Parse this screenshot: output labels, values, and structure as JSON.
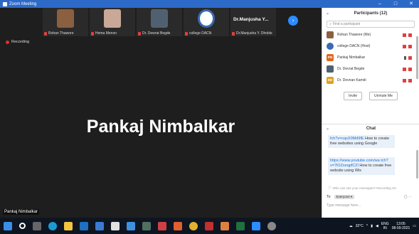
{
  "window": {
    "title": "Zoom Meeting",
    "controls": [
      "–",
      "□",
      "✕"
    ]
  },
  "thumbnails": [
    {
      "name": "Rohan Thawore",
      "face_color": "#8a6040"
    },
    {
      "name": "Hema Menon",
      "face_color": "#c9a898"
    },
    {
      "name": "Dr. Dewrat Begde",
      "face_color": "#506070"
    },
    {
      "name": "college DACN",
      "face_color": "#3a6ab0"
    },
    {
      "name": "Dr.Manjusha Y. Dhoble",
      "big_name": "Dr.Manjusha  Y..."
    }
  ],
  "recording_label": "Recording",
  "speaker": {
    "name": "Pankaj Nimbalkar"
  },
  "active_label": "Pankaj Nimbalkar",
  "participants_panel": {
    "title": "Participants (12)",
    "search_placeholder": "Find a participant",
    "items": [
      {
        "name": "Rohan Thawore (Me)",
        "avatar_color": "#8a6040",
        "initials": ""
      },
      {
        "name": "college DACN (Host)",
        "avatar_color": "#3a6ab0",
        "initials": ""
      },
      {
        "name": "Pankaj Nimbalkar",
        "avatar_color": "#e06820",
        "initials": "PN"
      },
      {
        "name": "Dr. Devrat Begde",
        "avatar_color": "#506070",
        "initials": ""
      },
      {
        "name": "Dr. Devnan Kamdi",
        "avatar_color": "#e0a020",
        "initials": "DD"
      }
    ],
    "invite_label": "Invite",
    "unmute_label": "Unmute Me"
  },
  "chat": {
    "title": "Chat",
    "messages": [
      {
        "link": "fch?v=cqsX0Md9fE",
        "text": " How to create free websites using Google"
      },
      {
        "link": "https://www.youtube.com/wa tch?v=7lOZxeqpfCZl",
        "text": " How to create free website using Wix"
      }
    ],
    "notice": "Who can see your messages? Recording On",
    "to_label": "To:",
    "to_value": "Everyone ▾",
    "input_placeholder": "Type message here..."
  },
  "taskbar": {
    "weather": "32°C",
    "lang": "ENG",
    "region": "IN",
    "time": "13:05",
    "date": "08-09-2021"
  }
}
